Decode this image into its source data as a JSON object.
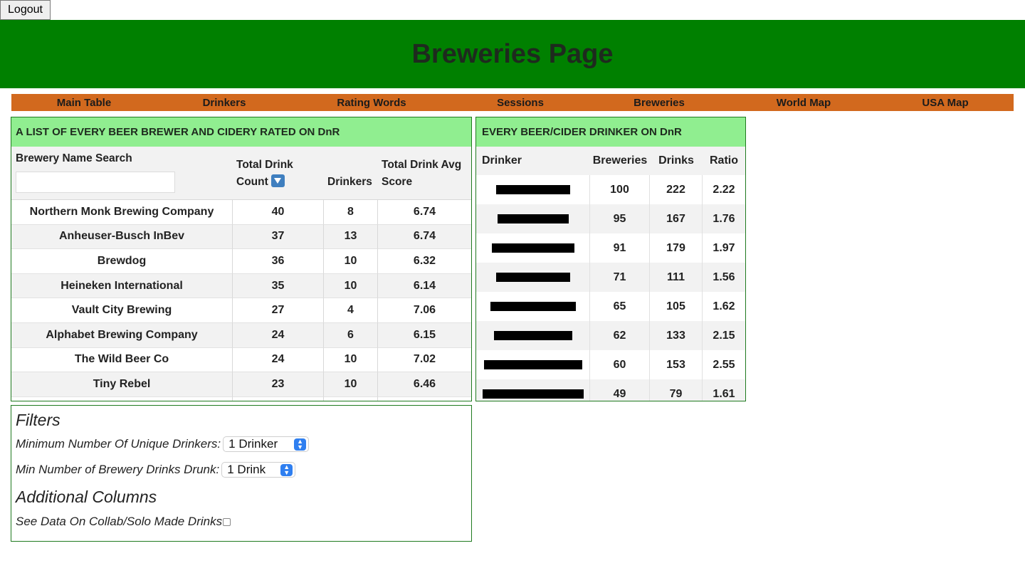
{
  "logout_label": "Logout",
  "page_title": "Breweries Page",
  "nav": [
    {
      "label": "Main Table"
    },
    {
      "label": "Drinkers"
    },
    {
      "label": "Rating Words"
    },
    {
      "label": "Sessions"
    },
    {
      "label": "Breweries"
    },
    {
      "label": "World Map"
    },
    {
      "label": "USA Map"
    }
  ],
  "brewery_table": {
    "title": "A LIST OF EVERY BEER BREWER AND CIDERY RATED ON DnR",
    "search_label": "Brewery Name Search",
    "search_value": "",
    "col_count_line1": "Total Drink",
    "col_count_line2": "Count",
    "sort_icon": "sort-down-icon",
    "col_drinkers": "Drinkers",
    "col_avg_line1": "Total Drink Avg",
    "col_avg_line2": "Score",
    "rows": [
      {
        "name": "Northern Monk Brewing Company",
        "count": "40",
        "drinkers": "8",
        "avg": "6.74"
      },
      {
        "name": "Anheuser-Busch InBev",
        "count": "37",
        "drinkers": "13",
        "avg": "6.74"
      },
      {
        "name": "Brewdog",
        "count": "36",
        "drinkers": "10",
        "avg": "6.32"
      },
      {
        "name": "Heineken International",
        "count": "35",
        "drinkers": "10",
        "avg": "6.14"
      },
      {
        "name": "Vault City Brewing",
        "count": "27",
        "drinkers": "4",
        "avg": "7.06"
      },
      {
        "name": "Alphabet Brewing Company",
        "count": "24",
        "drinkers": "6",
        "avg": "6.15"
      },
      {
        "name": "The Wild Beer Co",
        "count": "24",
        "drinkers": "10",
        "avg": "7.02"
      },
      {
        "name": "Tiny Rebel",
        "count": "23",
        "drinkers": "10",
        "avg": "6.46"
      }
    ]
  },
  "drinker_table": {
    "title": "EVERY BEER/CIDER DRINKER ON DnR",
    "col_drinker": "Drinker",
    "col_breweries": "Breweries",
    "col_drinks": "Drinks",
    "col_ratio": "Ratio",
    "rows": [
      {
        "breweries": "100",
        "drinks": "222",
        "ratio": "2.22"
      },
      {
        "breweries": "95",
        "drinks": "167",
        "ratio": "1.76"
      },
      {
        "breweries": "91",
        "drinks": "179",
        "ratio": "1.97"
      },
      {
        "breweries": "71",
        "drinks": "111",
        "ratio": "1.56"
      },
      {
        "breweries": "65",
        "drinks": "105",
        "ratio": "1.62"
      },
      {
        "breweries": "62",
        "drinks": "133",
        "ratio": "2.15"
      },
      {
        "breweries": "60",
        "drinks": "153",
        "ratio": "2.55"
      },
      {
        "breweries": "49",
        "drinks": "79",
        "ratio": "1.61"
      }
    ]
  },
  "filters": {
    "heading": "Filters",
    "min_drinkers_label": "Minimum Number Of Unique Drinkers:",
    "min_drinkers_value": "1 Drinker",
    "min_drinks_label": "Min Number of Brewery Drinks Drunk:",
    "min_drinks_value": "1 Drink",
    "additional_heading": "Additional Columns",
    "collab_label": "See Data On Collab/Solo Made Drinks",
    "collab_checked": false
  },
  "colors": {
    "banner": "#008000",
    "nav": "#d2691e",
    "panel_header": "#90ee90",
    "accent": "#2f7ff0"
  }
}
